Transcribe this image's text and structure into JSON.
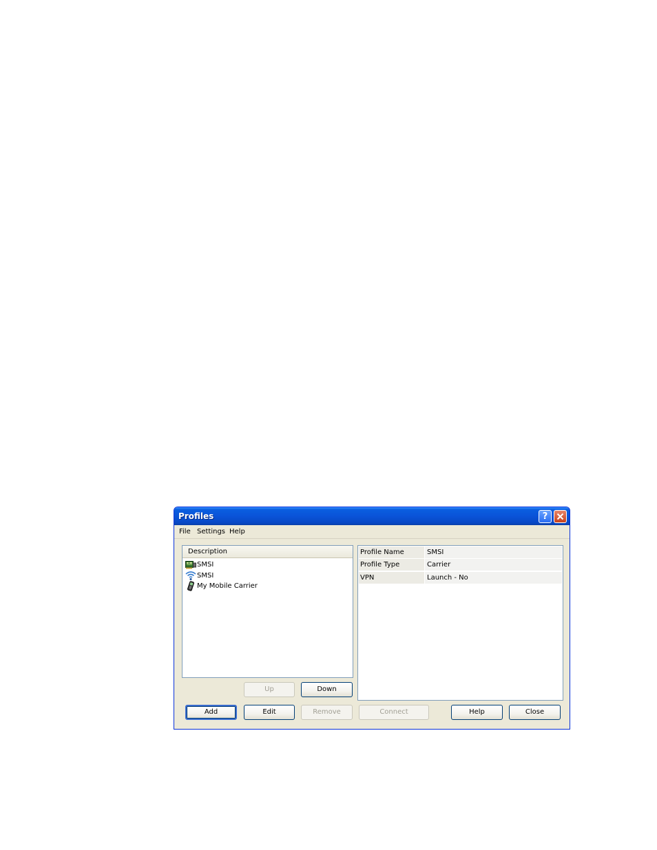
{
  "window": {
    "title": "Profiles",
    "help_glyph": "?"
  },
  "menu": {
    "items": [
      {
        "label": "File"
      },
      {
        "label": "Settings"
      },
      {
        "label": "Help"
      }
    ]
  },
  "profiles_list": {
    "column_header": "Description",
    "items": [
      {
        "label": "SMSI",
        "icon": "ethernet-card-icon"
      },
      {
        "label": "SMSI",
        "icon": "wifi-icon"
      },
      {
        "label": "My Mobile Carrier",
        "icon": "mobile-phone-icon"
      }
    ]
  },
  "properties": {
    "rows": [
      {
        "name": "Profile Name",
        "value": "SMSI"
      },
      {
        "name": "Profile Type",
        "value": "Carrier"
      },
      {
        "name": "VPN",
        "value": "Launch - No"
      }
    ]
  },
  "buttons": {
    "up": "Up",
    "down": "Down",
    "add": "Add",
    "edit": "Edit",
    "remove": "Remove",
    "connect": "Connect",
    "help": "Help",
    "close": "Close"
  },
  "colors": {
    "titlebar": "#0a53d8",
    "window_bg": "#ece9d8",
    "close_button": "#c8421c"
  }
}
